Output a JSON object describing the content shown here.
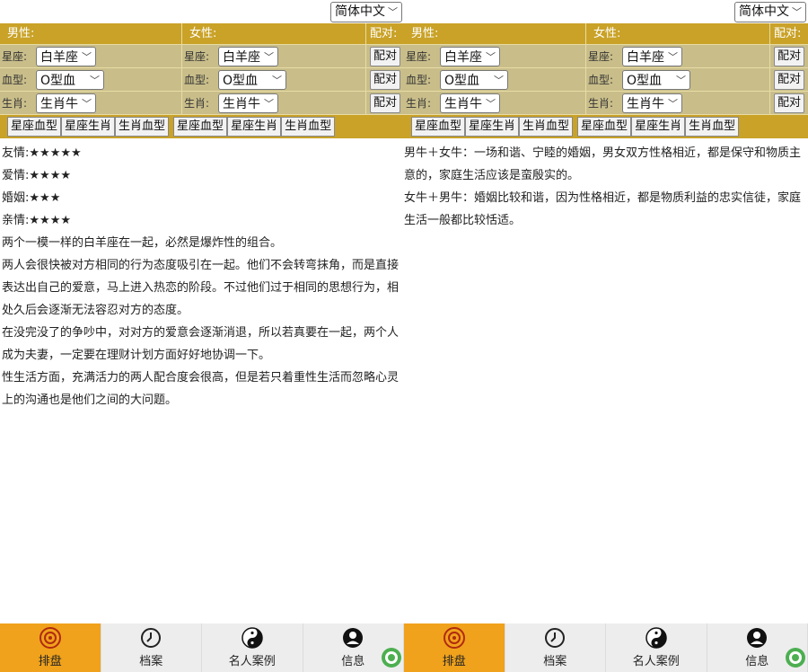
{
  "language": "简体中文",
  "panels": [
    {
      "header": {
        "male": "男性:",
        "female": "女性:",
        "pair": "配对:"
      },
      "rows": [
        {
          "label_m": "星座:",
          "value_m": "白羊座",
          "label_f": "星座:",
          "value_f": "白羊座",
          "pair": "配对"
        },
        {
          "label_m": "血型:",
          "value_m": "O型血",
          "label_f": "血型:",
          "value_f": "O型血",
          "pair": "配对"
        },
        {
          "label_m": "生肖:",
          "value_m": "生肖牛",
          "label_f": "生肖:",
          "value_f": "生肖牛",
          "pair": "配对"
        }
      ],
      "combos_male": [
        "星座血型",
        "星座生肖",
        "生肖血型"
      ],
      "combos_female": [
        "星座血型",
        "星座生肖",
        "生肖血型"
      ],
      "ratings": [
        {
          "label": "友情:",
          "stars": "★★★★★"
        },
        {
          "label": "爱情:",
          "stars": "★★★★"
        },
        {
          "label": "婚姻:",
          "stars": "★★★"
        },
        {
          "label": "亲情:",
          "stars": "★★★★"
        }
      ],
      "paragraphs": [
        "两个一模一样的白羊座在一起，必然是爆炸性的组合。",
        "两人会很快被对方相同的行为态度吸引在一起。他们不会转弯抹角，而是直接表达出自己的爱意，马上进入热恋的阶段。不过他们过于相同的思想行为，相处久后会逐渐无法容忍对方的态度。",
        "在没完没了的争吵中，对对方的爱意会逐渐消退，所以若真要在一起，两个人成为夫妻，一定要在理财计划方面好好地协调一下。",
        "性生活方面，充满活力的两人配合度会很高，但是若只着重性生活而忽略心灵上的沟通也是他们之间的大问题。"
      ]
    },
    {
      "header": {
        "male": "男性:",
        "female": "女性:",
        "pair": "配对:"
      },
      "rows": [
        {
          "label_m": "星座:",
          "value_m": "白羊座",
          "label_f": "星座:",
          "value_f": "白羊座",
          "pair": "配对"
        },
        {
          "label_m": "血型:",
          "value_m": "O型血",
          "label_f": "血型:",
          "value_f": "O型血",
          "pair": "配对"
        },
        {
          "label_m": "生肖:",
          "value_m": "生肖牛",
          "label_f": "生肖:",
          "value_f": "生肖牛",
          "pair": "配对"
        }
      ],
      "combos_male": [
        "星座血型",
        "星座生肖",
        "生肖血型"
      ],
      "combos_female": [
        "星座血型",
        "星座生肖",
        "生肖血型"
      ],
      "paragraphs": [
        "男牛＋女牛：一场和谐、宁睦的婚姻，男女双方性格相近，都是保守和物质主意的，家庭生活应该是蛮殷实的。",
        "女牛＋男牛：婚姻比较和谐，因为性格相近，都是物质利益的忠实信徒，家庭生活一般都比较恬适。"
      ]
    }
  ],
  "tabs": [
    "排盘",
    "档案",
    "名人案例",
    "信息"
  ],
  "colors": {
    "header_gold": "#c9a227",
    "form_bg": "#c9be8a",
    "tab_active": "#f0a21c",
    "tab_bg": "#ededed"
  }
}
